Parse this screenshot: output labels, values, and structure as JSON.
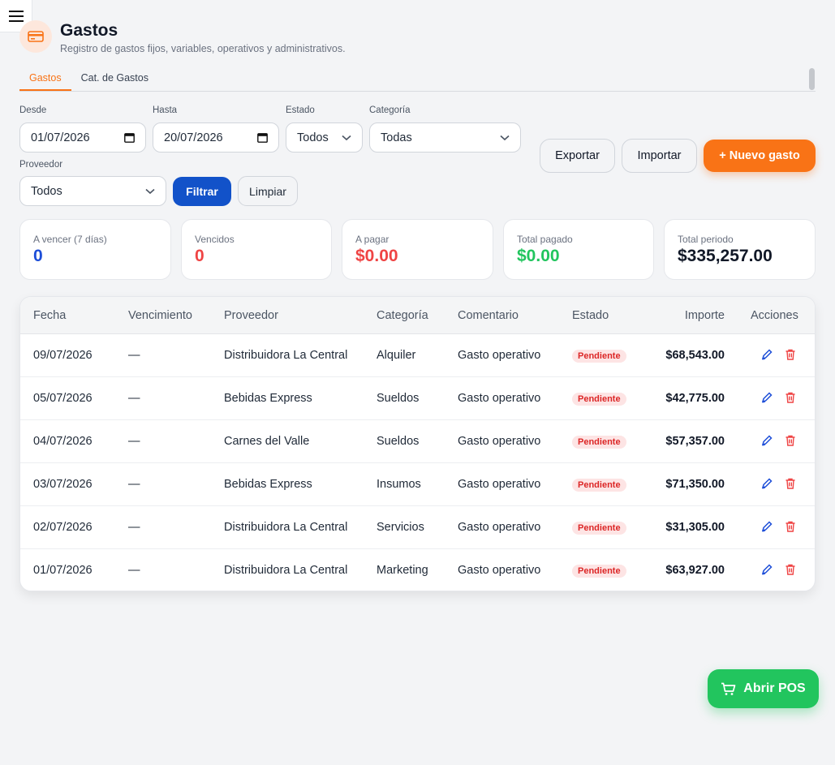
{
  "header": {
    "title": "Gastos",
    "subtitle": "Registro de gastos fijos, variables, operativos y administrativos."
  },
  "tabs": [
    {
      "label": "Gastos",
      "active": true
    },
    {
      "label": "Cat. de Gastos",
      "active": false
    }
  ],
  "filters": {
    "desde": {
      "label": "Desde",
      "value": "01/07/2026"
    },
    "hasta": {
      "label": "Hasta",
      "value": "20/07/2026"
    },
    "estado": {
      "label": "Estado",
      "value": "Todos"
    },
    "categoria": {
      "label": "Categoría",
      "value": "Todas"
    },
    "proveedor": {
      "label": "Proveedor",
      "value": "Todos"
    },
    "filter_label": "Filtrar",
    "clear_label": "Limpiar"
  },
  "actions": {
    "export_label": "Exportar",
    "import_label": "Importar",
    "new_label": "+ Nuevo gasto"
  },
  "summary": [
    {
      "label": "A vencer (7 días)",
      "value": "0",
      "color": "#1d4ed8"
    },
    {
      "label": "Vencidos",
      "value": "0",
      "color": "#ef4444"
    },
    {
      "label": "A pagar",
      "value": "$0.00",
      "color": "#ef4444"
    },
    {
      "label": "Total pagado",
      "value": "$0.00",
      "color": "#22c55e"
    },
    {
      "label": "Total periodo",
      "value": "$335,257.00",
      "color": "#111827"
    }
  ],
  "table": {
    "columns": [
      "Fecha",
      "Vencimiento",
      "Proveedor",
      "Categoría",
      "Comentario",
      "Estado",
      "Importe",
      "Acciones"
    ],
    "rows": [
      {
        "fecha": "09/07/2026",
        "vencimiento": "—",
        "proveedor": "Distribuidora La Central",
        "categoria": "Alquiler",
        "comentario": "Gasto operativo",
        "estado": "Pendiente",
        "importe": "$68,543.00"
      },
      {
        "fecha": "05/07/2026",
        "vencimiento": "—",
        "proveedor": "Bebidas Express",
        "categoria": "Sueldos",
        "comentario": "Gasto operativo",
        "estado": "Pendiente",
        "importe": "$42,775.00"
      },
      {
        "fecha": "04/07/2026",
        "vencimiento": "—",
        "proveedor": "Carnes del Valle",
        "categoria": "Sueldos",
        "comentario": "Gasto operativo",
        "estado": "Pendiente",
        "importe": "$57,357.00"
      },
      {
        "fecha": "03/07/2026",
        "vencimiento": "—",
        "proveedor": "Bebidas Express",
        "categoria": "Insumos",
        "comentario": "Gasto operativo",
        "estado": "Pendiente",
        "importe": "$71,350.00"
      },
      {
        "fecha": "02/07/2026",
        "vencimiento": "—",
        "proveedor": "Distribuidora La Central",
        "categoria": "Servicios",
        "comentario": "Gasto operativo",
        "estado": "Pendiente",
        "importe": "$31,305.00"
      },
      {
        "fecha": "01/07/2026",
        "vencimiento": "—",
        "proveedor": "Distribuidora La Central",
        "categoria": "Marketing",
        "comentario": "Gasto operativo",
        "estado": "Pendiente",
        "importe": "$63,927.00"
      }
    ]
  },
  "pos_button": {
    "label": "Abrir POS"
  },
  "colors": {
    "accent": "#f97316",
    "primary": "#1252c9",
    "success": "#22c55e",
    "danger": "#ef4444"
  },
  "icons": {
    "menu": "hamburger-menu-icon",
    "header": "credit-card-icon",
    "date": "calendar-icon",
    "select": "chevron-down-icon",
    "edit": "pencil-icon",
    "delete": "trash-icon",
    "pos": "shopping-cart-icon"
  }
}
